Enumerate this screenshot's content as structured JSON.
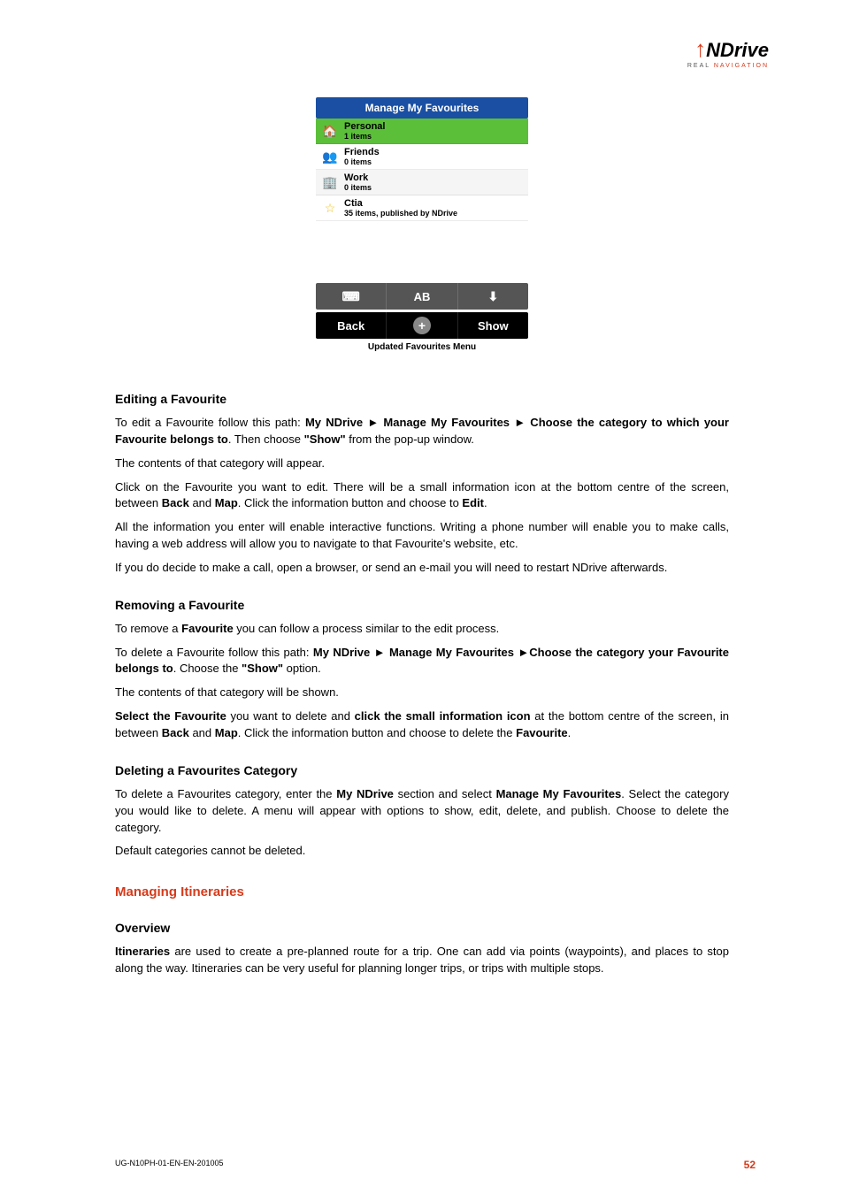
{
  "logo": {
    "text": "NDrive",
    "sub_prefix": "REAL",
    "sub_suffix": "NAVIGATION"
  },
  "favourites_header": "Manage My Favourites",
  "fav_items": [
    {
      "name": "Personal",
      "sub": "1 items"
    },
    {
      "name": "Friends",
      "sub": "0 items"
    },
    {
      "name": "Work",
      "sub": "0 items"
    },
    {
      "name": "Ctia",
      "sub": "35 items, published by NDrive"
    }
  ],
  "bar_top": {
    "mid": "AB"
  },
  "bar_bottom": {
    "left": "Back",
    "right": "Show"
  },
  "caption": "Updated Favourites Menu",
  "sections": {
    "editing_title": "Editing a Favourite",
    "editing_p1_a": "To edit a Favourite follow this path: ",
    "editing_p1_b": "My NDrive ► Manage My Favourites ► Choose the category to which your Favourite belongs to",
    "editing_p1_c": ". Then choose ",
    "editing_p1_d": "\"Show\"",
    "editing_p1_e": " from the pop-up window.",
    "editing_p2": "The contents of that category will appear.",
    "editing_p3_a": "Click on the Favourite you want to edit. There will be a small information icon at the bottom centre of the screen, between ",
    "editing_p3_b": "Back",
    "editing_p3_c": " and ",
    "editing_p3_d": "Map",
    "editing_p3_e": ". Click the information button and choose to ",
    "editing_p3_f": "Edit",
    "editing_p3_g": ".",
    "editing_p4": "All the information you enter will enable interactive functions. Writing a phone number will enable you to make calls, having a web address will allow you to navigate to that Favourite's website, etc.",
    "editing_p5": "If you do decide to make a call, open a browser, or send an e-mail you will need to restart NDrive afterwards.",
    "removing_title": "Removing a Favourite",
    "removing_p1_a": "To remove a ",
    "removing_p1_b": "Favourite",
    "removing_p1_c": " you can follow a process similar to the edit process.",
    "removing_p2_a": "To delete a Favourite follow this path: ",
    "removing_p2_b": "My NDrive ► Manage My Favourites ►Choose the category your Favourite belongs to",
    "removing_p2_c": ". Choose the ",
    "removing_p2_d": "\"Show\"",
    "removing_p2_e": " option.",
    "removing_p3": "The contents of that category will be shown.",
    "removing_p4_a": "Select the Favourite",
    "removing_p4_b": " you want to delete and ",
    "removing_p4_c": "click the small information icon",
    "removing_p4_d": " at the bottom centre of the screen, in between ",
    "removing_p4_e": "Back",
    "removing_p4_f": " and ",
    "removing_p4_g": "Map",
    "removing_p4_h": ". Click the information button and choose to delete the ",
    "removing_p4_i": "Favourite",
    "removing_p4_j": ".",
    "deleting_title": "Deleting a Favourites Category",
    "deleting_p1_a": "To delete a Favourites category, enter the ",
    "deleting_p1_b": "My NDrive",
    "deleting_p1_c": " section and select ",
    "deleting_p1_d": "Manage My Favourites",
    "deleting_p1_e": ". Select the category you would like to delete. A menu will appear with options to show, edit, delete, and publish. Choose to delete the category.",
    "deleting_p2": "Default categories cannot be deleted.",
    "itineraries_title": "Managing Itineraries",
    "overview_title": "Overview",
    "overview_p1_a": "Itineraries",
    "overview_p1_b": " are used to create a pre-planned route for a trip. One can add via points (waypoints), and places to stop along the way. Itineraries can be very useful for planning longer trips, or trips with multiple stops."
  },
  "footer": {
    "code": "UG-N10PH-01-EN-EN-201005",
    "page": "52"
  }
}
